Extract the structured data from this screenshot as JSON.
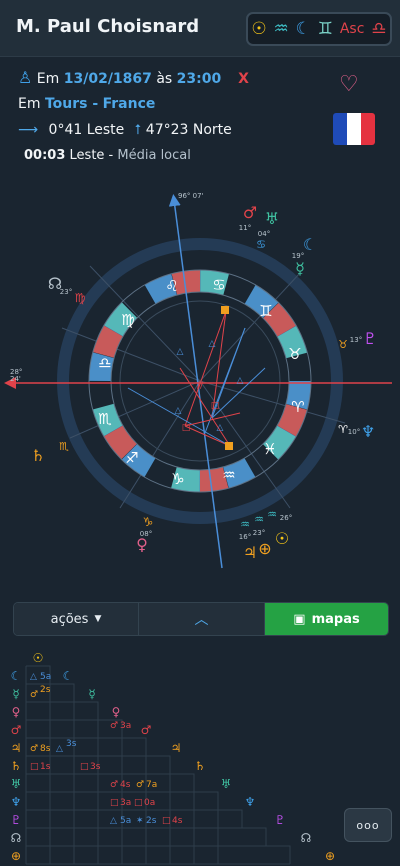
{
  "header": {
    "title": "M. Paul Choisnard",
    "signature": [
      {
        "icon": "sun-glyph",
        "glyph": "☉",
        "color": "#f5c518"
      },
      {
        "icon": "aquarius-glyph",
        "glyph": "♒",
        "color": "#3fc0c8"
      },
      {
        "icon": "moon-glyph",
        "glyph": "☾",
        "color": "#3fa0e8"
      },
      {
        "icon": "gemini-glyph",
        "glyph": "♊",
        "color": "#7bd3c8"
      },
      {
        "icon": "asc-label",
        "glyph": "Asc",
        "color": "#e0434a"
      },
      {
        "icon": "libra-glyph",
        "glyph": "♎",
        "color": "#e0434a"
      }
    ]
  },
  "birth": {
    "em_label": "Em",
    "date": "13/02/1867",
    "as_label": "às",
    "time": "23:00",
    "close": "X",
    "place_label": "Em",
    "city": "Tours -",
    "country": "France",
    "longitude": "0°41 Leste",
    "latitude": "47°23 Norte",
    "offset": "00:03",
    "offset_dir": "Leste -",
    "offset_desc": "Média local"
  },
  "chart": {
    "mc_label": "96° 07'",
    "asc_label": "28° 24'",
    "outer_labels": [
      {
        "text": "11°",
        "color": "#b7c3cc"
      },
      {
        "text": "04°",
        "color": "#b7c3cc"
      },
      {
        "text": "19°",
        "color": "#b7c3cc"
      },
      {
        "text": "23°",
        "color": "#b7c3cc"
      },
      {
        "text": "13°",
        "color": "#b7c3cc"
      },
      {
        "text": "10°",
        "color": "#b7c3cc"
      },
      {
        "text": "08°",
        "color": "#b7c3cc"
      },
      {
        "text": "16°",
        "color": "#b7c3cc"
      },
      {
        "text": "23°",
        "color": "#b7c3cc"
      },
      {
        "text": "26°",
        "color": "#b7c3cc"
      }
    ]
  },
  "toolbar": {
    "acoes": "ações",
    "mapas": "mapas"
  },
  "grid": {
    "cells": [
      "5a",
      "8s",
      "3s",
      "1s",
      "3a",
      "3s",
      "4s",
      "7a",
      "3a",
      "0a",
      "5a",
      "2s",
      "4s",
      "2s"
    ]
  },
  "more": "ooo"
}
